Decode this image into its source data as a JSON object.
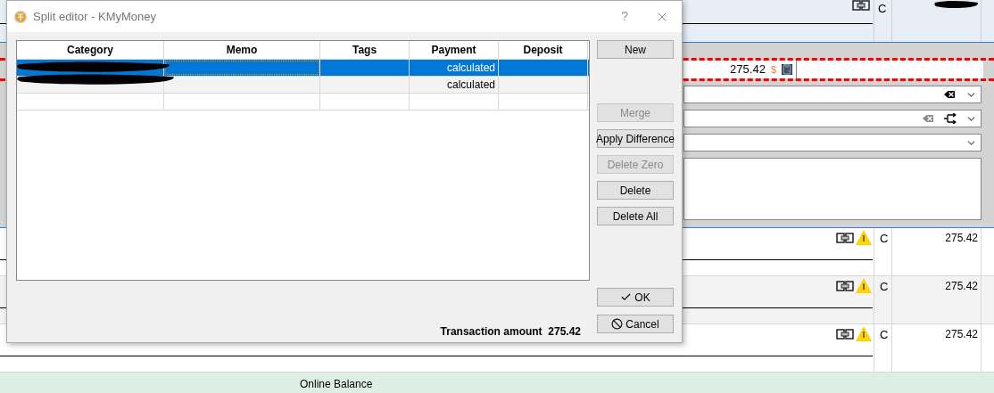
{
  "register": {
    "top_entry": {
      "status": "C"
    },
    "amount_field": {
      "value": "275.42",
      "currency": "$"
    },
    "combos": [
      {
        "kind": "clear-dark"
      },
      {
        "kind": "clear-split"
      },
      {
        "kind": "plain"
      }
    ],
    "entries": [
      {
        "status": "C",
        "amount": "275.42"
      },
      {
        "status": "C",
        "amount": "275.42"
      },
      {
        "status": "C",
        "amount": "275.42"
      }
    ],
    "footer": "Online Balance"
  },
  "dialog": {
    "title": "Split editor - KMyMoney",
    "help": "?",
    "table": {
      "columns": [
        "Category",
        "Memo",
        "Tags",
        "Payment",
        "Deposit"
      ],
      "rows": [
        {
          "selected": true,
          "payment": "calculated"
        },
        {
          "selected": false,
          "payment": "calculated"
        },
        {
          "selected": false
        }
      ]
    },
    "buttons_top": [
      {
        "label": "New",
        "disabled": false
      }
    ],
    "buttons_middle": [
      {
        "label": "Merge",
        "disabled": true
      },
      {
        "label": "Apply Difference",
        "disabled": false
      },
      {
        "label": "Delete Zero",
        "disabled": true
      },
      {
        "label": "Delete",
        "disabled": false
      },
      {
        "label": "Delete All",
        "disabled": false
      }
    ],
    "buttons_bottom": [
      {
        "label": "OK",
        "disabled": false,
        "kind": "check"
      },
      {
        "label": "Cancel",
        "disabled": false,
        "kind": "cancel"
      }
    ],
    "transaction_amount": {
      "label": "Transaction amount",
      "value": "275.42"
    }
  }
}
